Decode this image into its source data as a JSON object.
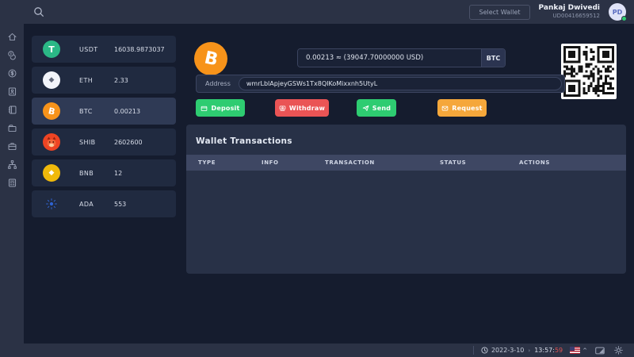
{
  "topbar": {
    "select_wallet_label": "Select Wallet",
    "user": {
      "name": "Pankaj Dwivedi",
      "id": "UD00416659512",
      "initials": "PD"
    }
  },
  "sidebar": {
    "items": [
      "home",
      "coins",
      "cash",
      "contacts",
      "ledger",
      "wallet",
      "briefcase",
      "network",
      "reports"
    ]
  },
  "coins": [
    {
      "symbol": "USDT",
      "balance": "16038.9873037"
    },
    {
      "symbol": "ETH",
      "balance": "2.33"
    },
    {
      "symbol": "BTC",
      "balance": "0.00213"
    },
    {
      "symbol": "SHIB",
      "balance": "2602600"
    },
    {
      "symbol": "BNB",
      "balance": "12"
    },
    {
      "symbol": "ADA",
      "balance": "553"
    }
  ],
  "wallet": {
    "amount_display": "0.00213 ≈ (39047.70000000 USD)",
    "currency": "BTC",
    "address_label": "Address",
    "address": "wmrLblApjeyGSWs1Tx8QIKoMixxnh5UtyL",
    "actions": {
      "deposit": "Deposit",
      "withdraw": "Withdraw",
      "send": "Send",
      "request": "Request"
    }
  },
  "transactions": {
    "title": "Wallet Transactions",
    "columns": [
      "TYPE",
      "INFO",
      "TRANSACTION",
      "STATUS",
      "ACTIONS"
    ],
    "rows": []
  },
  "statusbar": {
    "date": "2022-3-10",
    "separator": "›",
    "time": "13:57:",
    "seconds": "59"
  },
  "colors": {
    "accent_green": "#2ecc71",
    "accent_red": "#ea5455",
    "accent_orange": "#f5a73b",
    "btc_orange": "#f7931a",
    "usdt_green": "#2bb886",
    "bnb_yellow": "#f0b90b",
    "ada_blue": "#2f63d2",
    "seconds_red": "#e05252",
    "bar_bg": "#2b3245",
    "page_bg": "#151c2e"
  }
}
